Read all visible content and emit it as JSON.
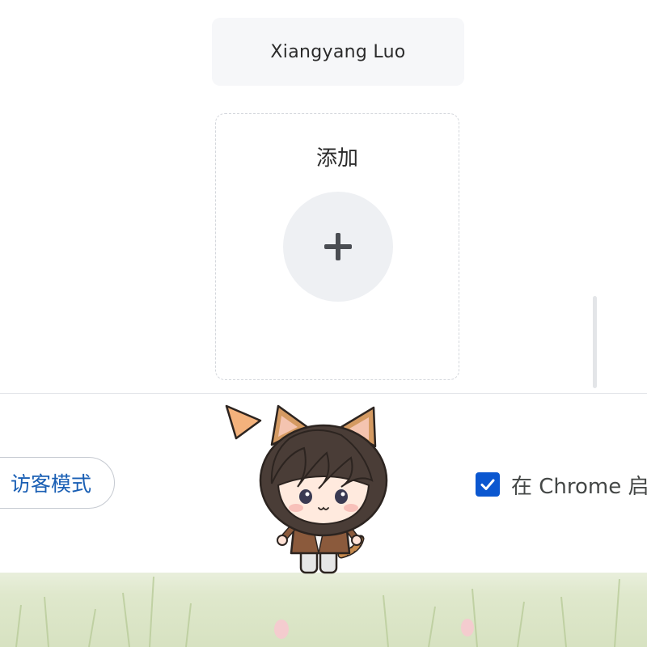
{
  "profile": {
    "name": "Xiangyang Luo"
  },
  "add_profile": {
    "label": "添加"
  },
  "footer": {
    "guest_label": "访客模式",
    "startup_label": "在 Chrome 启",
    "startup_checked": true
  },
  "icons": {
    "add": "plus-icon",
    "checkbox": "checkmark-icon",
    "mascot": "cat-boy-mascot"
  },
  "colors": {
    "accent": "#0b57d0",
    "link": "#1a5fb4",
    "card_bg": "#f6f7f9",
    "grass": "#d7e2c1"
  }
}
